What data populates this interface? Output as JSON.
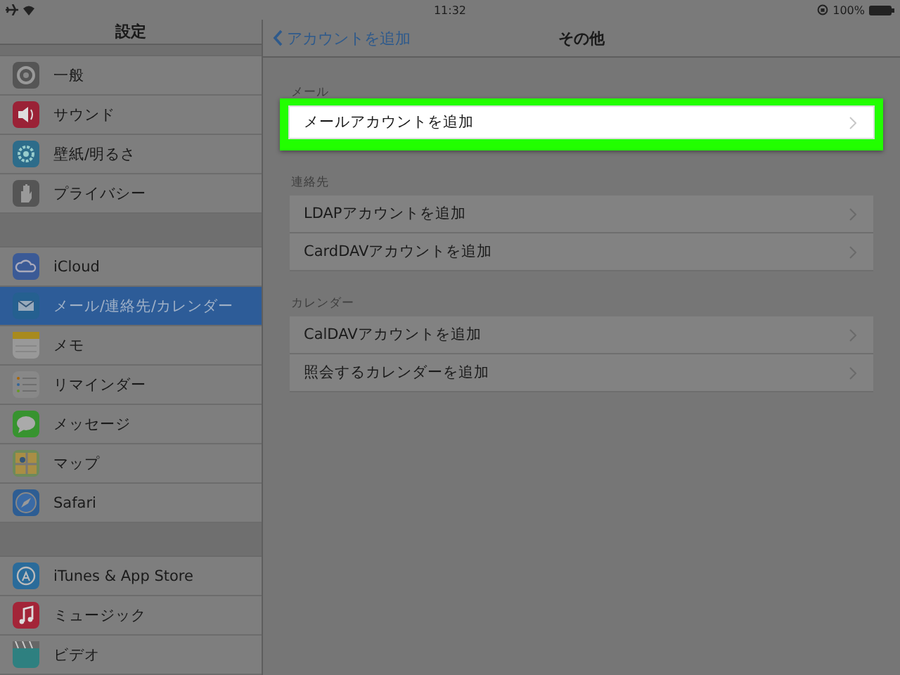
{
  "status_bar": {
    "time": "11:32",
    "battery": "100%"
  },
  "sidebar": {
    "title": "設定",
    "groups": [
      {
        "items": [
          {
            "label": "一般",
            "selected": false
          },
          {
            "label": "サウンド",
            "selected": false
          },
          {
            "label": "壁紙/明るさ",
            "selected": false
          },
          {
            "label": "プライバシー",
            "selected": false
          }
        ]
      },
      {
        "items": [
          {
            "label": "iCloud",
            "selected": false
          },
          {
            "label": "メール/連絡先/カレンダー",
            "selected": true
          },
          {
            "label": "メモ",
            "selected": false
          },
          {
            "label": "リマインダー",
            "selected": false
          },
          {
            "label": "メッセージ",
            "selected": false
          },
          {
            "label": "マップ",
            "selected": false
          },
          {
            "label": "Safari",
            "selected": false
          }
        ]
      },
      {
        "items": [
          {
            "label": "iTunes & App Store",
            "selected": false
          },
          {
            "label": "ミュージック",
            "selected": false
          },
          {
            "label": "ビデオ",
            "selected": false
          }
        ]
      }
    ]
  },
  "detail": {
    "back": "アカウントを追加",
    "title": "その他",
    "sections": [
      {
        "header": "メール",
        "rows": [
          {
            "label": "メールアカウントを追加",
            "highlighted": true
          }
        ]
      },
      {
        "header": "連絡先",
        "rows": [
          {
            "label": "LDAPアカウントを追加",
            "highlighted": false
          },
          {
            "label": "CardDAVアカウントを追加",
            "highlighted": false
          }
        ]
      },
      {
        "header": "カレンダー",
        "rows": [
          {
            "label": "CalDAVアカウントを追加",
            "highlighted": false
          },
          {
            "label": "照会するカレンダーを追加",
            "highlighted": false
          }
        ]
      }
    ]
  }
}
